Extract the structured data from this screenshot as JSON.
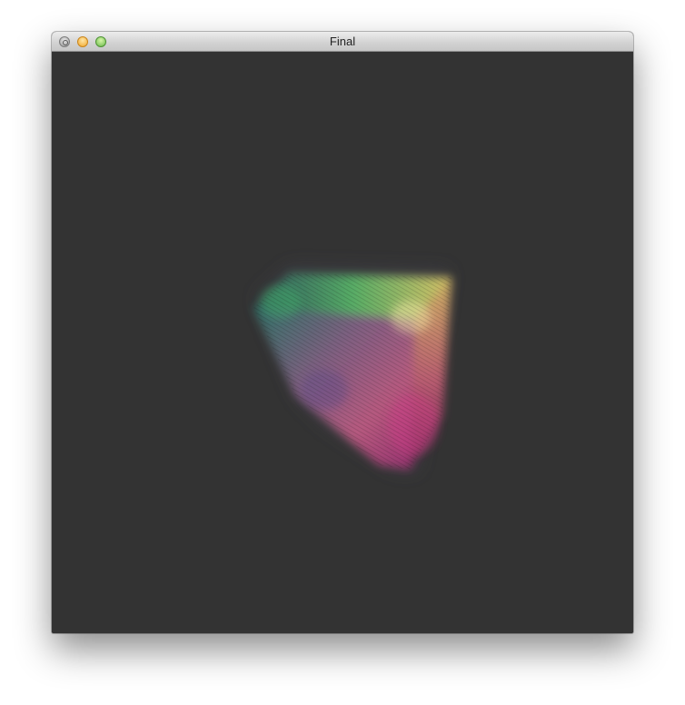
{
  "window": {
    "title": "Final",
    "controls": {
      "close_icon": "close-icon",
      "minimize_icon": "minimize-icon",
      "zoom_icon": "zoom-icon"
    }
  },
  "colors": {
    "canvas_background": "#333333",
    "cube_green": "#3fb86a",
    "cube_yellow": "#e8d06a",
    "cube_magenta": "#d83a8a",
    "cube_purple": "#5a4a8a",
    "cube_teal": "#2f7b74"
  }
}
